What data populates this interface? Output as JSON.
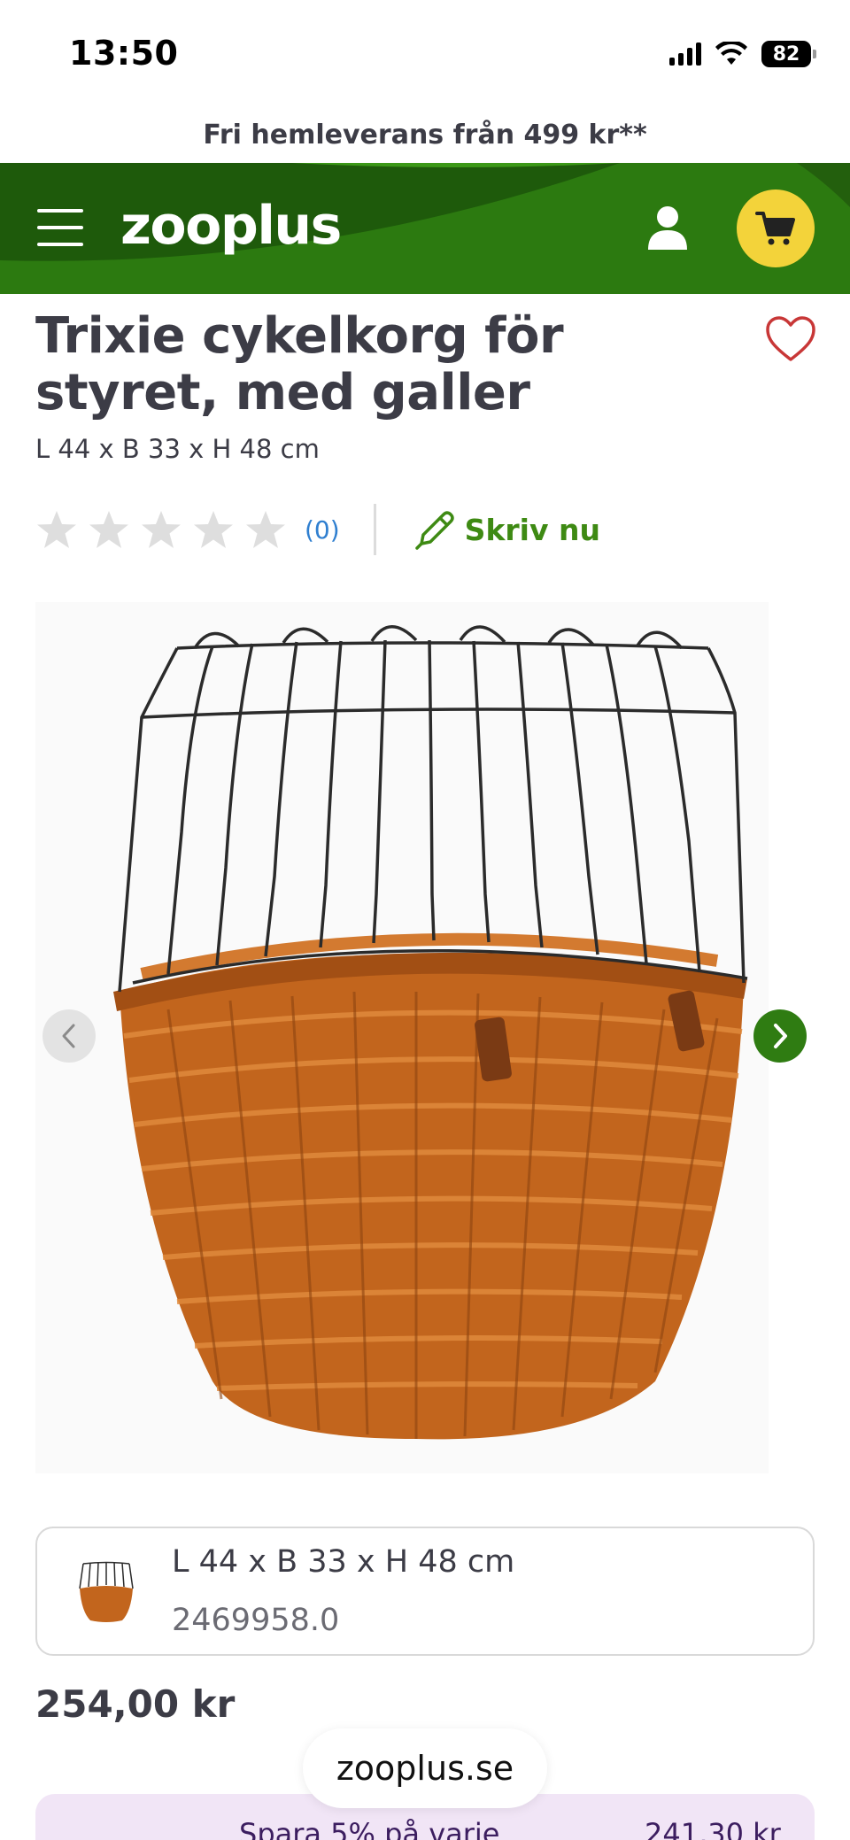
{
  "status_bar": {
    "time": "13:50",
    "battery": "82"
  },
  "promo_banner": "Fri hemleverans från 499 kr**",
  "header": {
    "logo": "zooplus"
  },
  "product": {
    "title_line1": "Trixie cykelkorg för",
    "title_line2": "styret, med galler",
    "subtitle": "L 44 x B 33 x H 48 cm",
    "rating": {
      "value": 0,
      "max": 5,
      "count_label": "(0)"
    },
    "write_review_label": "Skriv nu",
    "price": "254,00 kr"
  },
  "variant": {
    "size": "L 44 x B 33 x H 48 cm",
    "sku": "2469958.0"
  },
  "browser": {
    "url": "zooplus.se"
  },
  "savings_offer": {
    "text": "Spara 5% på varje",
    "price": "241,30 kr"
  },
  "colors": {
    "brand_green_dark": "#1f5f0c",
    "brand_green_light": "#3e8a13",
    "cart_yellow": "#f3d33a",
    "text_dark": "#3c3c46",
    "link_blue": "#2f7fd0",
    "savings_bg": "#f1e5f6"
  },
  "icons": [
    "signal-icon",
    "wifi-icon",
    "battery-icon",
    "hamburger-menu-icon",
    "account-icon",
    "cart-icon",
    "heart-icon",
    "star-icon",
    "pencil-icon",
    "chevron-left-icon",
    "chevron-right-icon"
  ]
}
